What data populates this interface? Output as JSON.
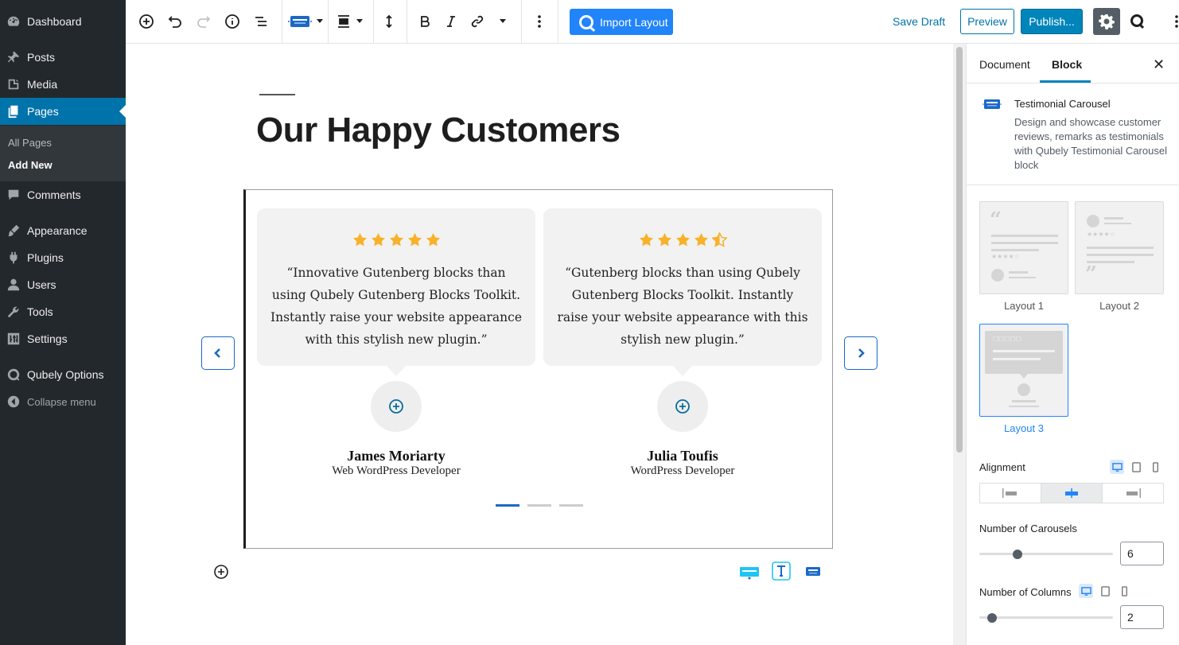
{
  "admin_menu": {
    "items": [
      {
        "label": "Dashboard",
        "icon": "dashboard-icon"
      },
      {
        "label": "Posts",
        "icon": "pin-icon"
      },
      {
        "label": "Media",
        "icon": "media-icon"
      },
      {
        "label": "Pages",
        "icon": "pages-icon"
      },
      {
        "label": "Comments",
        "icon": "comment-icon"
      },
      {
        "label": "Appearance",
        "icon": "brush-icon"
      },
      {
        "label": "Plugins",
        "icon": "plugin-icon"
      },
      {
        "label": "Users",
        "icon": "user-icon"
      },
      {
        "label": "Tools",
        "icon": "wrench-icon"
      },
      {
        "label": "Settings",
        "icon": "settings-sliders-icon"
      },
      {
        "label": "Qubely Options",
        "icon": "qubely-icon"
      }
    ],
    "sub_items": [
      "All Pages",
      "Add New"
    ],
    "collapse_label": "Collapse menu"
  },
  "toolbar": {
    "import_label": "Import Layout",
    "save_draft_label": "Save Draft",
    "preview_label": "Preview",
    "publish_label": "Publish..."
  },
  "editor": {
    "page_title": "Our Happy Customers",
    "testimonials": [
      {
        "quote": "“Innovative Gutenberg blocks than using Qubely Gutenberg Blocks Toolkit. Instantly raise your website appearance with this stylish new plugin.”",
        "name": "James Moriarty",
        "role": "Web WordPress Developer",
        "rating": 5
      },
      {
        "quote": "“Gutenberg blocks than using Qubely Gutenberg Blocks Toolkit. Instantly raise your website appearance with this stylish new plugin.”",
        "name": "Julia Toufis",
        "role": "WordPress Developer",
        "rating": 4.5
      }
    ],
    "active_dot": 0,
    "dot_count": 3
  },
  "sidebar": {
    "tab_document": "Document",
    "tab_block": "Block",
    "block_title": "Testimonial Carousel",
    "block_description": "Design and showcase customer reviews, remarks as testimonials with Qubely Testimonial Carousel block",
    "layouts": [
      "Layout 1",
      "Layout 2",
      "Layout 3"
    ],
    "selected_layout": "Layout 3",
    "alignment_label": "Alignment",
    "carousels_label": "Number of Carousels",
    "carousels_value": "6",
    "columns_label": "Number of Columns",
    "columns_value": "2"
  },
  "colors": {
    "accent": "#2184f9",
    "wp_blue": "#0073aa",
    "star": "#f7b22a",
    "admin_bg": "#23282d"
  }
}
